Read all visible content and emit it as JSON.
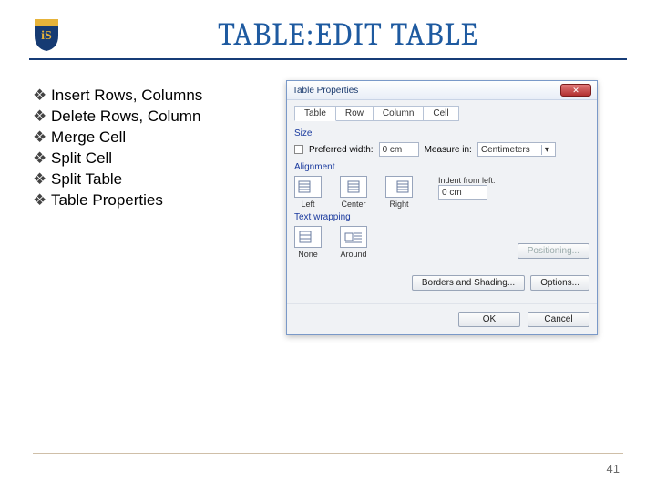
{
  "slide": {
    "title": "TABLE:EDIT TABLE",
    "page_number": "41",
    "bullets": [
      "Insert Rows, Columns",
      "Delete Rows, Column",
      "Merge Cell",
      "Split Cell",
      "Split Table",
      "Table Properties"
    ]
  },
  "dialog": {
    "title": "Table Properties",
    "tabs": [
      "Table",
      "Row",
      "Column",
      "Cell"
    ],
    "active_tab": "Table",
    "size": {
      "group": "Size",
      "pref_width_label": "Preferred width:",
      "pref_width_value": "0 cm",
      "measure_label": "Measure in:",
      "measure_value": "Centimeters"
    },
    "alignment": {
      "group": "Alignment",
      "options": [
        "Left",
        "Center",
        "Right"
      ],
      "indent_label": "Indent from left:",
      "indent_value": "0 cm"
    },
    "wrapping": {
      "group": "Text wrapping",
      "options": [
        "None",
        "Around"
      ],
      "positioning": "Positioning..."
    },
    "buttons": {
      "borders": "Borders and Shading...",
      "options": "Options...",
      "ok": "OK",
      "cancel": "Cancel"
    }
  }
}
